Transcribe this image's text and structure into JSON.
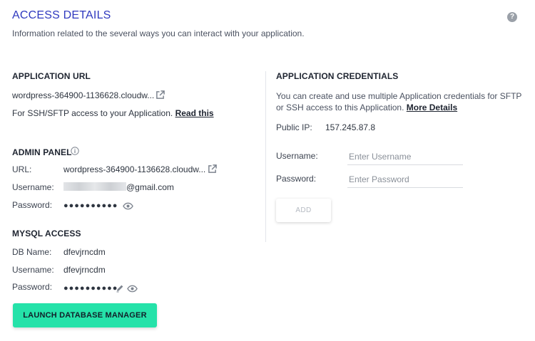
{
  "header": {
    "title": "ACCESS DETAILS",
    "subtitle": "Information related to the several ways you can interact with your application.",
    "help_icon": "question-circle-icon"
  },
  "app_url": {
    "heading": "APPLICATION URL",
    "url": "wordpress-364900-1136628.cloudw...",
    "ssh_text": "For SSH/SFTP access to your Application.",
    "ssh_link": "Read this"
  },
  "admin_panel": {
    "heading": "ADMIN PANEL",
    "url_label": "URL:",
    "url_value": "wordpress-364900-1136628.cloudw...",
    "username_label": "Username:",
    "username_value": "@gmail.com",
    "password_label": "Password:",
    "password_value": "●●●●●●●●●●"
  },
  "mysql": {
    "heading": "MYSQL ACCESS",
    "db_label": "DB Name:",
    "db_value": "dfevjrncdm",
    "username_label": "Username:",
    "username_value": "dfevjrncdm",
    "password_label": "Password:",
    "password_value": "●●●●●●●●●●",
    "launch_label": "LAUNCH DATABASE MANAGER"
  },
  "credentials": {
    "heading": "APPLICATION CREDENTIALS",
    "desc_line1": "You can create and use multiple Application credentials for SFTP",
    "desc_line2": "or SSH access to this Application.",
    "desc_link": "More Details",
    "ip_label": "Public IP:",
    "ip_value": "157.245.87.8",
    "username_label": "Username:",
    "username_placeholder": "Enter Username",
    "password_label": "Password:",
    "password_placeholder": "Enter Password",
    "add_label": "ADD"
  },
  "colors": {
    "title": "#2f39bf",
    "launch_button": "#25e2a9"
  }
}
